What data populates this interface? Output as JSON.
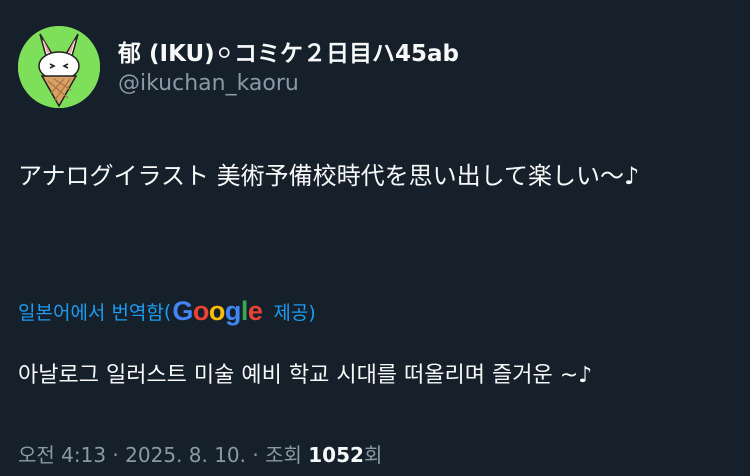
{
  "author": {
    "display_name": "郁 (IKU)⚪コミケ２日目ハ45ab",
    "handle": "@ikuchan_kaoru",
    "avatar_icon": "rabbit-ice-cream-avatar"
  },
  "tweet": {
    "text": "アナログイラスト 美術予備校時代を思い出して楽しい～♪"
  },
  "translation": {
    "label": "일본어에서 번역함",
    "paren_open": "(",
    "google_g1": "G",
    "google_o1": "o",
    "google_o2": "o",
    "google_g2": "g",
    "google_l": "l",
    "google_e": "e",
    "provided": "제공)",
    "text": "아날로그 일러스트 미술 예비 학교 시대를 떠올리며 즐거운 ~♪"
  },
  "meta": {
    "time": "오전 4:13",
    "separator": " · ",
    "date": "2025. 8. 10.",
    "views_label": "조회",
    "views_count": "1052",
    "views_suffix": "회"
  },
  "colors": {
    "background": "#15202b",
    "text_primary": "#f7f9f9",
    "text_secondary": "#8b98a5",
    "accent": "#1d9bf0",
    "avatar_bg": "#7ee05a"
  }
}
